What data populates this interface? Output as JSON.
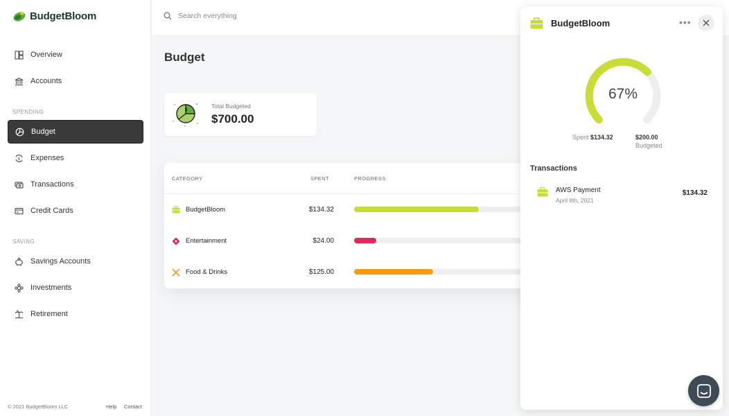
{
  "app": {
    "name": "BudgetBloom",
    "accent": "#c9dd36"
  },
  "sidebar": {
    "overview": "Overview",
    "accounts": "Accounts",
    "spending_section": "SPENDING",
    "budget": "Budget",
    "expenses": "Expenses",
    "transactions": "Transactions",
    "credit_cards": "Credit Cards",
    "saving_section": "SAVING",
    "savings_accounts": "Savings Accounts",
    "investments": "Investments",
    "retirement": "Retirement",
    "footer": {
      "copyright": "© 2021 BudgetBloom LLC",
      "help": "Help",
      "contact": "Contact"
    }
  },
  "search": {
    "placeholder": "Search everything"
  },
  "main": {
    "title": "Budget",
    "total": {
      "label": "Total Budgeted",
      "value": "$700.00"
    },
    "table": {
      "headers": {
        "category": "CATEGORY",
        "spent": "SPENT",
        "progress": "PROGRESS"
      },
      "rows": [
        {
          "category": "BudgetBloom",
          "spent": "$134.32",
          "progress": 0.6,
          "color": "#c9dd36",
          "icon": "briefcase-icon"
        },
        {
          "category": "Entertainment",
          "spent": "$24.00",
          "progress": 0.107,
          "color": "#e5265a",
          "icon": "ticket-icon"
        },
        {
          "category": "Food & Drinks",
          "spent": "$125.00",
          "progress": 0.38,
          "color": "#f59a12",
          "icon": "utensils-icon"
        }
      ]
    }
  },
  "panel": {
    "title": "BudgetBloom",
    "more": "•••",
    "gauge": {
      "percent_label": "67%",
      "fraction": 0.67
    },
    "spent_label": "Spent",
    "spent_value": "$134.32",
    "budgeted_value": "$200.00",
    "budgeted_label": "Budgeted",
    "transactions_title": "Transactions",
    "transactions": [
      {
        "name": "AWS Payment",
        "date": "April 8th, 2021",
        "amount": "$134.32"
      }
    ]
  }
}
